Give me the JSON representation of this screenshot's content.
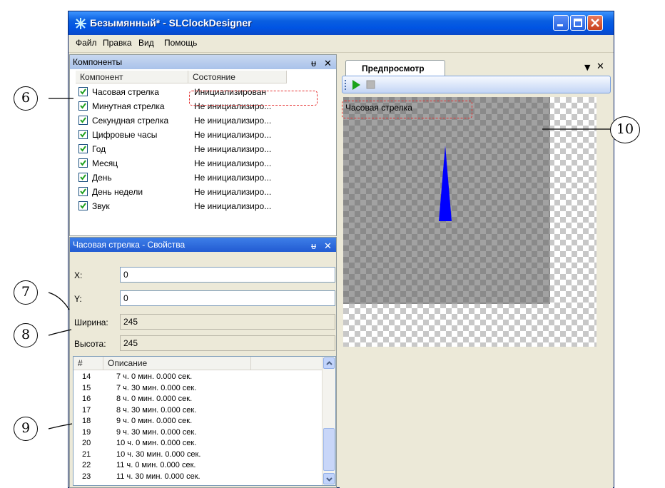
{
  "window": {
    "title": "Безымянный* - SLClockDesigner"
  },
  "menu": [
    "Файл",
    "Правка",
    "Вид",
    "Помощь"
  ],
  "components_panel": {
    "title": "Компоненты",
    "pin_glyph": "ᵾ",
    "close_glyph": "✕",
    "columns": [
      "Компонент",
      "Состояние"
    ],
    "rows": [
      {
        "name": "Часовая стрелка",
        "state": "Инициализирован",
        "checked": true
      },
      {
        "name": "Минутная стрелка",
        "state": "Не инициализиро...",
        "checked": true
      },
      {
        "name": "Секундная стрелка",
        "state": "Не инициализиро...",
        "checked": true
      },
      {
        "name": "Цифровые часы",
        "state": "Не инициализиро...",
        "checked": true
      },
      {
        "name": "Год",
        "state": "Не инициализиро...",
        "checked": true
      },
      {
        "name": "Месяц",
        "state": "Не инициализиро...",
        "checked": true
      },
      {
        "name": "День",
        "state": "Не инициализиро...",
        "checked": true
      },
      {
        "name": "День недели",
        "state": "Не инициализиро...",
        "checked": true
      },
      {
        "name": "Звук",
        "state": "Не инициализиро...",
        "checked": true
      }
    ]
  },
  "properties_panel": {
    "title": "Часовая стрелка - Свойства",
    "fields": [
      {
        "label": "X:",
        "value": "0",
        "editable": true
      },
      {
        "label": "Y:",
        "value": "0",
        "editable": true
      },
      {
        "label": "Ширина:",
        "value": "245",
        "editable": false
      },
      {
        "label": "Высота:",
        "value": "245",
        "editable": false
      }
    ],
    "list_columns": [
      "#",
      "Описание"
    ],
    "list_rows": [
      {
        "n": "14",
        "d": "7 ч.  0 мин.  0.000 сек."
      },
      {
        "n": "15",
        "d": "7 ч. 30 мин.  0.000 сек."
      },
      {
        "n": "16",
        "d": "8 ч.  0 мин.  0.000 сек."
      },
      {
        "n": "17",
        "d": "8 ч. 30 мин.  0.000 сек."
      },
      {
        "n": "18",
        "d": "9 ч.  0 мин.  0.000 сек."
      },
      {
        "n": "19",
        "d": "9 ч. 30 мин.  0.000 сек."
      },
      {
        "n": "20",
        "d": "10 ч.  0 мин.  0.000 сек."
      },
      {
        "n": "21",
        "d": "10 ч. 30 мин.  0.000 сек."
      },
      {
        "n": "22",
        "d": "11 ч.  0 мин.  0.000 сек."
      },
      {
        "n": "23",
        "d": "11 ч. 30 мин.  0.000 сек."
      }
    ]
  },
  "preview": {
    "tab_label": "Предпросмотр",
    "component_label": "Часовая стрелка",
    "hand_color": "#0000ff"
  },
  "callouts": [
    "6",
    "7",
    "8",
    "9",
    "10"
  ],
  "colors": {
    "highlight": "#e53030",
    "titlebar": "#0054e3"
  }
}
